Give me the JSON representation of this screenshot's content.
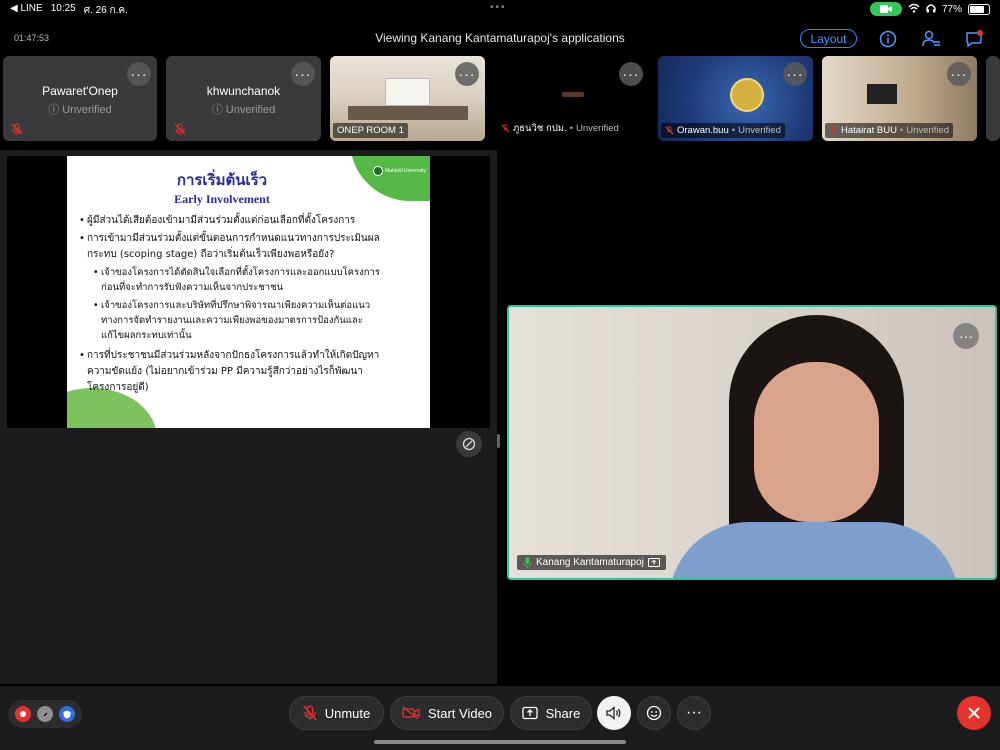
{
  "status_bar": {
    "back_app": "◀ LINE",
    "time": "10:25",
    "date": "ศ. 26 ก.ค.",
    "battery": "77%",
    "battery_level": 0.77
  },
  "header": {
    "timer": "01:47:53",
    "title": "Viewing Kanang Kantamaturapoj's applications",
    "layout_label": "Layout"
  },
  "participants": [
    {
      "name": "Pawaret'Onep",
      "status": "Unverified",
      "type": "avatar"
    },
    {
      "name": "khwunchanok",
      "status": "Unverified",
      "type": "avatar"
    },
    {
      "name": "ONEP ROOM 1",
      "status": "",
      "type": "video"
    },
    {
      "name": "ภูธนวิช กปม.",
      "status": "Unverified",
      "type": "video"
    },
    {
      "name": "Orawan.buu",
      "status": "Unverified",
      "type": "video"
    },
    {
      "name": "Hatairat BUU",
      "status": "Unverified",
      "type": "video"
    }
  ],
  "slide": {
    "title": "การเริ่มต้นเร็ว",
    "subtitle": "Early Involvement",
    "logo_text": "Mahidol University",
    "bullets": [
      "ผู้มีส่วนได้เสียต้องเข้ามามีส่วนร่วมตั้งแต่ก่อนเลือกที่ตั้งโครงการ",
      "การเข้ามามีส่วนร่วมตั้งแต่ขั้นตอนการกำหนดแนวทางการประเมินผล",
      "กระทบ (scoping stage) ถือว่าเริ่มต้นเร็วเพียงพอหรือยัง?",
      "เจ้าของโครงการได้ตัดสินใจเลือกที่ตั้งโครงการและออกแบบโครงการ",
      "ก่อนที่จะทำการรับฟังความเห็นจากประชาชน",
      "เจ้าของโครงการและบริษัทที่ปรึกษาพิจารณาเพียงความเห็นต่อแนว",
      "ทางการจัดทำรายงานและความเพียงพอของมาตรการป้องกันและ",
      "แก้ไขผลกระทบเท่านั้น",
      "การที่ประชาชนมีส่วนร่วมหลังจากปักธงโครงการแล้วทำให้เกิดปัญหา",
      "ความขัดแย้ง (ไม่อยากเข้าร่วม PP  มีความรู้สึกว่าอย่างไรก็พัฒนา",
      "โครงการอยู่ดี)"
    ]
  },
  "active_speaker": {
    "name": "Kanang Kantamaturapoj"
  },
  "toolbar": {
    "unmute_label": "Unmute",
    "start_video_label": "Start Video",
    "share_label": "Share"
  },
  "colors": {
    "accent": "#4a9bff",
    "active_border": "#2ec4a0",
    "leave": "#e5322d",
    "muted": "#e5322d"
  }
}
